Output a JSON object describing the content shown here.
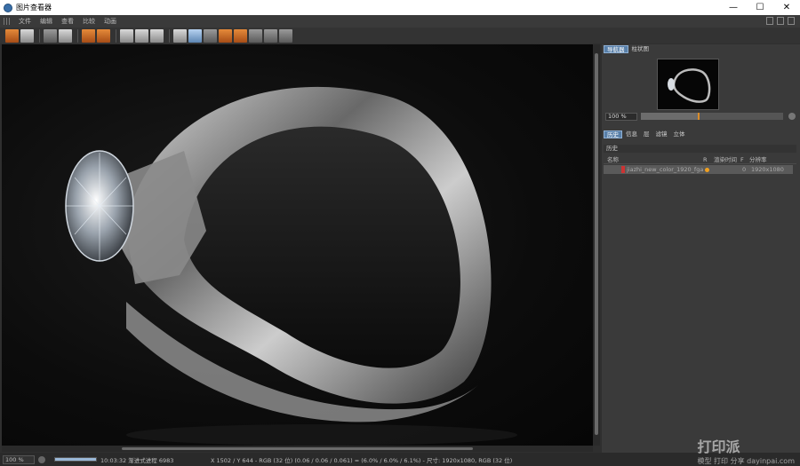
{
  "window": {
    "title": "图片查看器"
  },
  "window_controls": {
    "minimize": "—",
    "maximize": "☐",
    "close": "✕"
  },
  "menu": [
    "文件",
    "编辑",
    "查看",
    "比较",
    "动画"
  ],
  "navigator_tabs": [
    "导航器",
    "柱状图"
  ],
  "zoom": {
    "value": "100 %",
    "level_fraction": 0.4
  },
  "info_tabs": [
    "历史",
    "信息",
    "层",
    "滤镜",
    "立体"
  ],
  "history": {
    "title": "历史",
    "columns": [
      "名称",
      "R",
      "渲染时间",
      "F",
      "分辨率"
    ],
    "rows": [
      {
        "name": "jiazhi_new_color_1920_fga",
        "time": "",
        "frame": "0",
        "resolution": "1920x1080"
      }
    ]
  },
  "status": {
    "zoom": "100 %",
    "progress_fraction": 1.0,
    "progress_text": "10:03:32 渐进式进程 6983",
    "pixel_info": "X 1502 / Y 644 - RGB (32 位) (0.06 / 0.06 / 0.061) = (6.0% / 6.0% / 6.1%) - 尺寸: 1920x1080, RGB (32 位)"
  },
  "watermark": {
    "brand": "打印派",
    "sub": "模型 打印 分享",
    "url": "dayinpai.com"
  },
  "colors": {
    "accent_tab": "#587fa8",
    "progress_marker": "#d98c2a",
    "history_dot": "#f0a020",
    "history_swatch": "#cc3333"
  }
}
